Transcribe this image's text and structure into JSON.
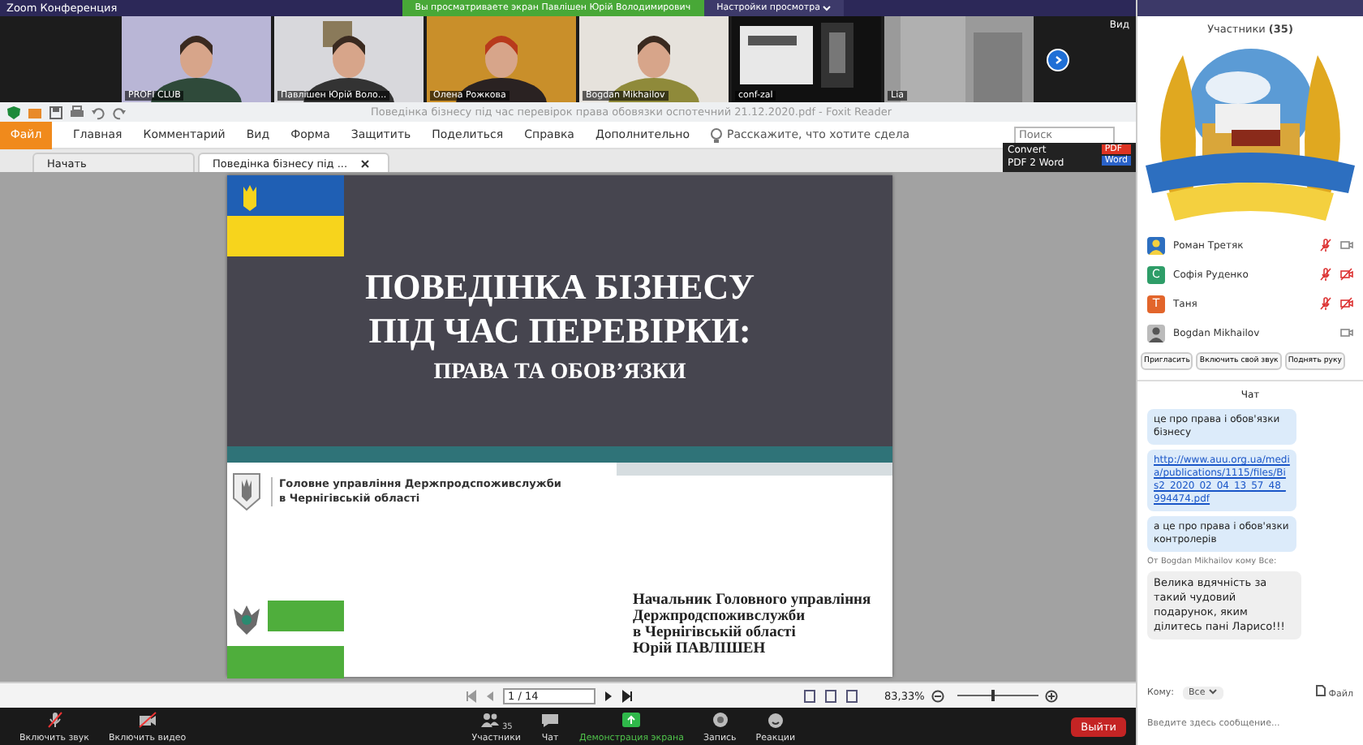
{
  "zoom_window": {
    "title": "Zoom Конференция"
  },
  "share_banner": {
    "text": "Вы просматриваете экран Павлішен Юрій Володимирович",
    "view_options": "Настройки просмотра"
  },
  "video_strip": {
    "view_label": "Вид",
    "tiles": [
      {
        "name": "PROFI CLUB"
      },
      {
        "name": "Павлішен Юрій Воло..."
      },
      {
        "name": "Олена Рожкова"
      },
      {
        "name": "Bogdan Mikhailov"
      },
      {
        "name": "conf-zal"
      },
      {
        "name": "Lia"
      }
    ]
  },
  "reader": {
    "title": "Поведінка бізнесу під час перевірок права обовязки оспотечний 21.12.2020.pdf - Foxit Reader",
    "file_button": "Файл",
    "menu": [
      "Главная",
      "Комментарий",
      "Вид",
      "Форма",
      "Защитить",
      "Поделиться",
      "Справка",
      "Дополнительно"
    ],
    "tell_me": "Расскажите, что хотите сдела",
    "search": {
      "placeholder": "Поиск"
    },
    "tabs": [
      {
        "label": "Начать",
        "selected": false
      },
      {
        "label": "Поведінка бізнесу під ...",
        "selected": true
      }
    ],
    "convert": {
      "line_1": "Convert",
      "line_2": "PDF 2 Word",
      "badge_top": "PDF",
      "badge_bottom": "Word"
    }
  },
  "slide": {
    "title_lines": [
      "ПОВЕДІНКА БІЗНЕСУ",
      "ПІД ЧАС ПЕРЕВІРКИ:"
    ],
    "subtitle": "ПРАВА ТА ОБОВ’ЯЗКИ",
    "org_lines": [
      "Головне управління Держпродспоживслужби",
      "в Чернігівській області"
    ],
    "signature_lines": [
      "Начальник Головного управління",
      "Держпродспоживслужби",
      "в Чернігівській області",
      "Юрій ПАВЛІШЕН"
    ]
  },
  "pdf_toolbar": {
    "page": "1 / 14",
    "zoom": "83,33%",
    "zoom_slider": {
      "level": 0.42
    }
  },
  "meeting_controls": [
    {
      "label": "Включить звук",
      "kind": "mic"
    },
    {
      "label": "Включить видео",
      "kind": "video"
    },
    {
      "label": "Участники",
      "kind": "participants",
      "count": "35"
    },
    {
      "label": "Чат",
      "kind": "chat"
    },
    {
      "label": "Демонстрация экрана",
      "kind": "share"
    },
    {
      "label": "Запись",
      "kind": "record"
    },
    {
      "label": "Реакции",
      "kind": "reactions"
    }
  ],
  "leave_button": "Выйти",
  "participants": {
    "title": "Участники **(35)**",
    "items": [
      {
        "name": "Роман Третяк",
        "mic_muted": true,
        "video_off": false
      },
      {
        "name": "Софія Руденко",
        "letter": "С",
        "color": "#2e9d68",
        "mic_muted": true,
        "video_off": true
      },
      {
        "name": "Таня",
        "letter": "Т",
        "color": "#e2652b",
        "mic_muted": true,
        "video_off": true
      },
      {
        "name": "Bogdan Mikhailov",
        "mic_muted": false,
        "video_off": false
      }
    ],
    "buttons": [
      "Пригласить",
      "Включить свой звук",
      "Поднять руку"
    ]
  },
  "chat": {
    "title": "Чат",
    "messages": [
      {
        "kind": "sent",
        "text": "це про права і обов'язки бізнесу"
      },
      {
        "kind": "link",
        "text": "http://www.auu.org.ua/media/publications/1115/files/Bis2_2020_02_04_13_57_48_994474.pdf"
      },
      {
        "kind": "sent",
        "text": "а це про права і обов'язки контролерів"
      },
      {
        "kind": "sender",
        "text": "От Bogdan Mikhailov кому Все:"
      },
      {
        "kind": "received",
        "text": "Велика вдячність за такий чудовий подарунок, яким ділитесь пані Ларисо!!!"
      }
    ],
    "to_label": "Кому:",
    "recipient": "Все",
    "file": "Файл",
    "input": {
      "placeholder": "Введите здесь сообщение..."
    }
  }
}
